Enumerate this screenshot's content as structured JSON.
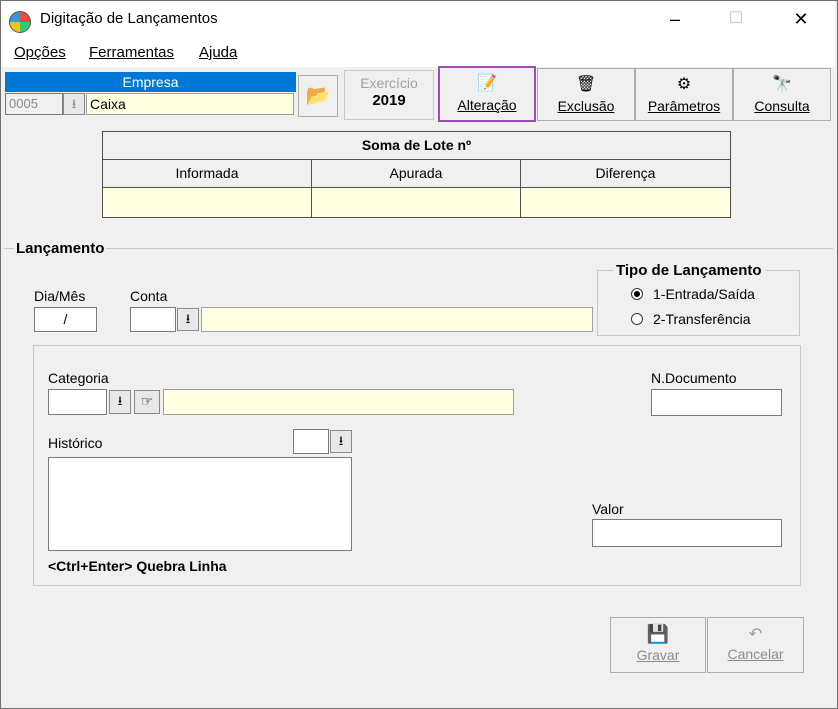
{
  "window": {
    "title": "Digitação de Lançamentos",
    "minimize": "–",
    "maximize": "☐",
    "close": "✕"
  },
  "menu": [
    {
      "label": "Opções"
    },
    {
      "label": "Ferramentas"
    },
    {
      "label": "Ajuda"
    }
  ],
  "empresa": {
    "header": "Empresa",
    "code": "0005",
    "name": "Caixa"
  },
  "exercicio": {
    "label": "Exercício",
    "year": "2019"
  },
  "toolbar": {
    "alteracao": "Alteração",
    "exclusao": "Exclusão",
    "parametros": "Parâmetros",
    "consulta": "Consulta"
  },
  "lote": {
    "title": "Soma de Lote nº",
    "col1": "Informada",
    "col2": "Apurada",
    "col3": "Diferença"
  },
  "lancamento": {
    "group_title": "Lançamento",
    "dia_mes_label": "Dia/Mês",
    "dia_mes_value": "/",
    "conta_label": "Conta",
    "tipo": {
      "title": "Tipo de Lançamento",
      "opt1": "1-Entrada/Saída",
      "opt2": "2-Transferência",
      "selected": "1-Entrada/Saída"
    },
    "categoria_label": "Categoria",
    "ndocumento_label": "N.Documento",
    "historico_label": "Histórico",
    "valor_label": "Valor",
    "hint": "<Ctrl+Enter> Quebra Linha"
  },
  "actions": {
    "gravar": "Gravar",
    "cancelar": "Cancelar"
  },
  "colors": {
    "accent_blue": "#0078d7",
    "field_yellow": "#ffffe1",
    "highlight_border": "#9b4db3"
  }
}
